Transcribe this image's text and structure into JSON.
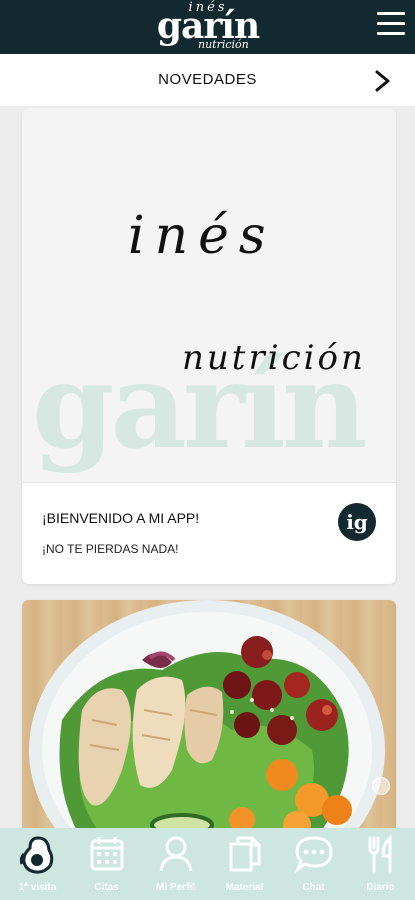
{
  "header": {
    "logo_top": "inés",
    "logo_main": "garín",
    "logo_sub": "nutrición",
    "menu_icon": "hamburger-menu-icon"
  },
  "section": {
    "title": "NOVEDADES",
    "next_icon": "chevron-right-icon"
  },
  "cards": [
    {
      "hero_watermark": "garín",
      "hero_script_top": "inés",
      "hero_script_bottom": "nutrición",
      "title": "¡BIENVENIDO A MI APP!",
      "subtitle": "¡NO TE PIERDAS NADA!",
      "badge": "ig"
    },
    {
      "image": "salad-with-grilled-chicken-photo"
    }
  ],
  "bottom_nav": [
    {
      "label": "1ª visita",
      "icon": "avocado-icon"
    },
    {
      "label": "Citas",
      "icon": "calendar-icon"
    },
    {
      "label": "Mi Perfil",
      "icon": "user-icon"
    },
    {
      "label": "Material",
      "icon": "documents-icon"
    },
    {
      "label": "Chat",
      "icon": "chat-bubble-icon"
    },
    {
      "label": "Diario",
      "icon": "fork-knife-icon"
    }
  ],
  "colors": {
    "topbar": "#12292f",
    "nav_bg": "#cde6e0",
    "watermark": "#d6e8e1"
  }
}
